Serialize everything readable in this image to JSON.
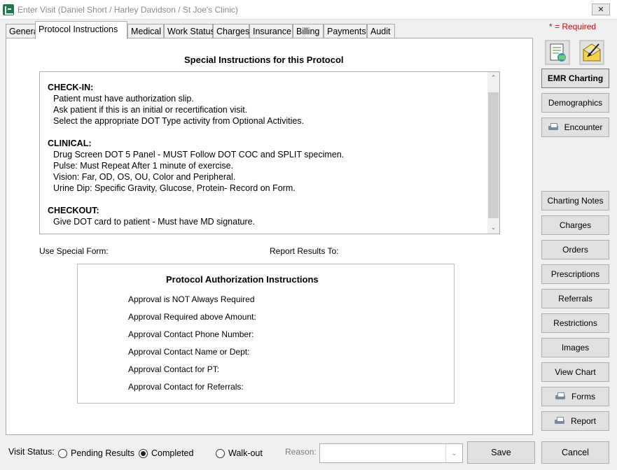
{
  "window": {
    "title": "Enter Visit (Daniel Short / Harley Davidson / St Joe's Clinic)",
    "close_glyph": "✕",
    "required_note": "* = Required"
  },
  "tabs": [
    {
      "label": "General"
    },
    {
      "label": "Protocol Instructions",
      "active": true
    },
    {
      "label": "Medical"
    },
    {
      "label": "Work Status"
    },
    {
      "label": "Charges"
    },
    {
      "label": "Insurance"
    },
    {
      "label": "Billing"
    },
    {
      "label": "Payments"
    },
    {
      "label": "Audit"
    }
  ],
  "protocol": {
    "special_title": "Special Instructions for this Protocol",
    "sections": [
      {
        "heading": "CHECK-IN:",
        "lines": [
          "Patient must have authorization slip.",
          "Ask patient if this is an initial or recertification visit.",
          "Select the appropriate DOT Type activity from Optional Activities."
        ]
      },
      {
        "heading": "CLINICAL:",
        "lines": [
          "Drug Screen DOT 5 Panel - MUST Follow DOT COC and SPLIT specimen.",
          "Pulse: Must Repeat  After 1 minute of exercise.",
          "Vision: Far, OD, OS, OU, Color and Peripheral.",
          "Urine Dip:  Specific Gravity, Glucose, Protein- Record on Form."
        ]
      },
      {
        "heading": "CHECKOUT:",
        "lines": [
          "Give DOT card to patient - Must have MD signature."
        ]
      }
    ],
    "use_special_form_label": "Use Special Form:",
    "report_results_to_label": "Report Results To:",
    "auth_title": "Protocol Authorization Instructions",
    "auth_lines": [
      "Approval is NOT Always Required",
      "Approval Required above Amount:",
      "Approval Contact Phone Number:",
      "Approval Contact Name or Dept:",
      "Approval Contact for PT:",
      "Approval Contact for Referrals:"
    ]
  },
  "sidebar": {
    "emr_charting": "EMR Charting",
    "demographics": "Demographics",
    "encounter": "Encounter",
    "charting_notes": "Charting Notes",
    "charges": "Charges",
    "orders": "Orders",
    "prescriptions": "Prescriptions",
    "referrals": "Referrals",
    "restrictions": "Restrictions",
    "images": "Images",
    "view_chart": "View Chart",
    "forms": "Forms",
    "report": "Report"
  },
  "footer": {
    "visit_status_label": "Visit Status:",
    "status_options": [
      {
        "label": "Pending Results",
        "checked": false
      },
      {
        "label": "Completed",
        "checked": true
      },
      {
        "label": "Walk-out",
        "checked": false
      }
    ],
    "reason_label": "Reason:",
    "reason_value": "",
    "save_label": "Save",
    "cancel_label": "Cancel"
  },
  "colors": {
    "required": "#e00000",
    "app_icon": "#1e7a4e"
  }
}
